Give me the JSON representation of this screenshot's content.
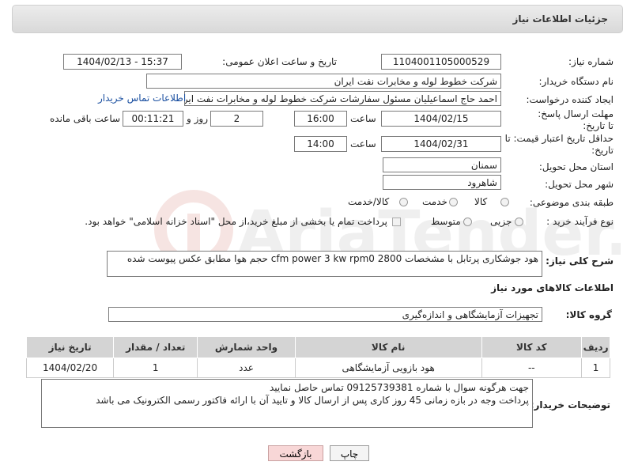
{
  "header": {
    "title": "جزئیات اطلاعات نیاز"
  },
  "form": {
    "need_number_label": "شماره نیاز:",
    "need_number": "1104001105000529",
    "announce_label": "تاریخ و ساعت اعلان عمومی:",
    "announce_value": "1404/02/13 - 15:37",
    "buyer_org_label": "نام دستگاه خریدار:",
    "buyer_org": "شرکت خطوط لوله و مخابرات نفت ایران",
    "requester_label": "ایجاد کننده درخواست:",
    "requester": "احمد  حاج اسماعیلیان مسئول سفارشات  شرکت خطوط لوله و مخابرات نفت ایر",
    "contact_link": "اطلاعات تماس خریدار",
    "deadline_label": "مهلت ارسال پاسخ: تا تاریخ:",
    "deadline_date": "1404/02/15",
    "time_label": "ساعت",
    "deadline_time": "16:00",
    "days_value": "2",
    "days_label": "روز و",
    "remaining_time": "00:11:21",
    "remaining_label": "ساعت باقی مانده",
    "min_price_label": "حداقل تاریخ اعتبار قیمت: تا تاریخ:",
    "min_price_date": "1404/02/31",
    "min_price_time": "14:00",
    "province_label": "استان محل تحویل:",
    "province": "سمنان",
    "city_label": "شهر محل تحویل:",
    "city": "شاهرود",
    "category_label": "طبقه بندی موضوعی:",
    "category_options": [
      "کالا",
      "خدمت",
      "کالا/خدمت"
    ],
    "process_label": "نوع فرآیند خرید :",
    "process_options": [
      "جزیی",
      "متوسط"
    ],
    "payment_note": "پرداخت تمام یا بخشی از مبلغ خرید،از محل \"اسناد خزانه اسلامی\" خواهد بود."
  },
  "description": {
    "label": "شرح کلی نیاز:",
    "text": "هود جوشکاری پرتابل با مشخصات cfm power 3 kw rpm0 2800 حجم هوا مطابق عکس پیوست شده"
  },
  "goods": {
    "section_title": "اطلاعات کالاهای مورد نیاز",
    "group_label": "گروه کالا:",
    "group_value": "تجهیزات آزمایشگاهی و اندازه‌گیری",
    "columns": [
      "ردیف",
      "کد کالا",
      "نام کالا",
      "واحد شمارش",
      "تعداد / مقدار",
      "تاریخ نیاز"
    ],
    "rows": [
      [
        "1",
        "--",
        "هود بازویی آزمایشگاهی",
        "عدد",
        "1",
        "1404/02/20"
      ]
    ]
  },
  "buyer_notes": {
    "label": "توضیحات خریدار:",
    "line1": "جهت هرگونه سوال با شماره 09125739381 تماس حاصل نمایید",
    "line2": "پرداخت وجه در بازه زمانی 45 روز کاری پس از ارسال کالا و تایید آن با ارائه فاکتور رسمی الکترونیک می باشد"
  },
  "buttons": {
    "print": "چاپ",
    "back": "بازگشت"
  },
  "watermark": {
    "text": "AriaTender.net"
  },
  "colors": {
    "link": "#1a4fa0",
    "back_button": "#f8d7d7"
  }
}
